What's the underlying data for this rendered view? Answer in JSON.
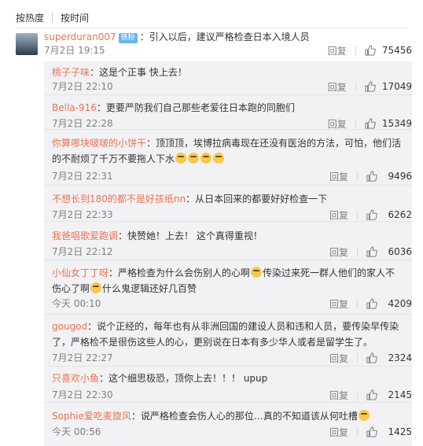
{
  "sort": {
    "hot": "按热度",
    "time": "按时间"
  },
  "main_comment": {
    "username": "superduran007",
    "badge": "铁粉",
    "text": "：引入以后，建议严格检查日本入境人员",
    "time": "7月2日 19:15",
    "reply_label": "回复",
    "likes": "75456"
  },
  "replies": [
    {
      "username": "桃子子味",
      "text": "：这是个正事 快上去！",
      "time": "7月2日 22:10",
      "reply_label": "回复",
      "likes": "17049"
    },
    {
      "username": "Bella-916",
      "text": "：更要严防我们自己那些老爱往日本跑的同胞们",
      "time": "7月2日 22:28",
      "reply_label": "回复",
      "likes": "15349"
    },
    {
      "username": "你算哪块啵啵的小饼干",
      "text": "：顶顶顶，埃博拉病毒现在还没有医治的方法，可怕，他们活的不耐烦了千万不要拖人下水",
      "time": "7月2日 22:31",
      "reply_label": "回复",
      "likes": "9496"
    },
    {
      "username": "不想长到180的都不是好孩纸nn",
      "text": "：从日本回来的都要好好检查一下",
      "time": "7月2日 22:33",
      "reply_label": "回复",
      "likes": "6262"
    },
    {
      "username": "我爸唱歌爱跑调",
      "text": "：快赞她！上去！ 这个真得重视！",
      "time": "7月2日 22:12",
      "reply_label": "回复",
      "likes": "6036"
    },
    {
      "username": "小仙女丁丁呀",
      "text": "：严格检查为什么会伤别人的心啊",
      "text2": "传染过来死一群人他们的家人不伤心了啊",
      "text3": "什么鬼逻辑还好几百赞",
      "time": "今天 00:10",
      "reply_label": "回复",
      "likes": "4209"
    },
    {
      "username": "gougod",
      "text": "：说个正经的，每年也有从非洲回国的建设人员和违和人员，要传染早传染了，严格检不是很伤这些人的心，更别说在日本有多少华人或者是留学生了。",
      "time": "7月2日 22:27",
      "reply_label": "回复",
      "likes": "2324"
    },
    {
      "username": "只喜欢小鱼",
      "text": "：这个细思极恐，顶你上去！！！ upup",
      "time": "7月2日 22:30",
      "reply_label": "回复",
      "likes": "2145"
    },
    {
      "username": "Sophie爱吃麦旋风",
      "text": "：说严格检查会伤人心的那位…真的不知道该从何吐槽",
      "time": "今天 00:56",
      "reply_label": "回复",
      "likes": "1425"
    }
  ],
  "icons": {
    "like": "thumbs-up-icon",
    "emoji": "emoji-icon"
  },
  "colors": {
    "username": "#eb7350",
    "reply_bg": "#f2f2f5",
    "meta": "#808080"
  }
}
